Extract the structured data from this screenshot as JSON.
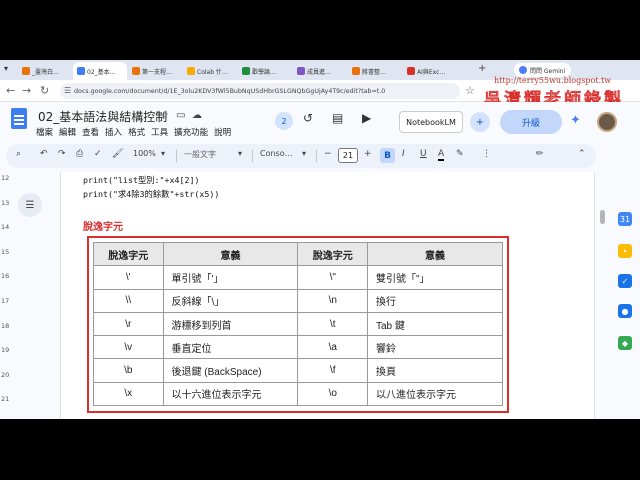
{
  "browser": {
    "tabs": [
      {
        "label": "_臺灣白…",
        "color": "#e8710a"
      },
      {
        "label": "02_基本…",
        "color": "#3d7ef3",
        "active": true
      },
      {
        "label": "第一支程…",
        "color": "#e8710a"
      },
      {
        "label": "Colab 什…",
        "color": "#f9ab00"
      },
      {
        "label": "歡學論…",
        "color": "#1e8e3e"
      },
      {
        "label": "成員進…",
        "color": "#7e57c2"
      },
      {
        "label": "將書整…",
        "color": "#e8710a"
      },
      {
        "label": "AI與Exc…",
        "color": "#d93025"
      }
    ],
    "new_tab": "+",
    "gemini_label": "問問 Gemini",
    "url": "docs.google.com/document/d/1E_3olu2KDV3fWl5BubNqUSdHbrGSLGNQbGgUjAy4T9c/edit?tab=t.0"
  },
  "watermark": {
    "url": "http://terry55wu.blogspot.tw",
    "name": "吳清輝老師錄製"
  },
  "docs": {
    "title": "02_基本語法與結構控制",
    "menu": [
      "檔案",
      "編輯",
      "查看",
      "插入",
      "格式",
      "工具",
      "擴充功能",
      "說明"
    ],
    "collaborators": "2",
    "notebooklm": "NotebookLM",
    "upgrade": "升級"
  },
  "toolbar": {
    "zoom": "100%",
    "style": "一般文字",
    "font": "Conso…",
    "font_size": "21",
    "bold": "B",
    "italic": "I",
    "underline": "U",
    "text_color": "A"
  },
  "ruler": [
    "12",
    "13",
    "14",
    "15",
    "16",
    "17",
    "18",
    "19",
    "20",
    "21"
  ],
  "content": {
    "code_lines": [
      "print(\"list型別:\"+x4[2])",
      "print(\"求4除3的餘數\"+str(x5))"
    ],
    "section_title": "脫逸字元",
    "table": {
      "headers": [
        "脫逸字元",
        "意義",
        "脫逸字元",
        "意義"
      ],
      "rows": [
        [
          "\\'",
          "單引號「'」",
          "\\\"",
          "雙引號「\"」"
        ],
        [
          "\\\\",
          "反斜線「\\」",
          "\\n",
          "換行"
        ],
        [
          "\\r",
          "游標移到列首",
          "\\t",
          "Tab 鍵"
        ],
        [
          "\\v",
          "垂直定位",
          "\\a",
          "響鈴"
        ],
        [
          "\\b",
          "後退鍵 (BackSpace)",
          "\\f",
          "換頁"
        ],
        [
          "\\x",
          "以十六進位表示字元",
          "\\o",
          "以八進位表示字元"
        ]
      ]
    }
  },
  "colors": {
    "accent_red": "#d9302e",
    "docs_blue": "#3d7ef3",
    "upgrade_bg": "#c2d7fa"
  }
}
